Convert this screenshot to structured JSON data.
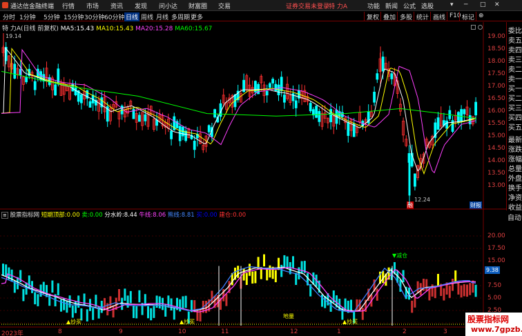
{
  "menu": {
    "app_title": "通达信金融终端",
    "items": [
      "行情",
      "市场",
      "资讯",
      "发现",
      "问小达",
      "财富圈",
      "交易"
    ],
    "login_status": "证券交易未登录",
    "stock_short": "特 力A",
    "right_items": [
      "功能",
      "新闻",
      "公式",
      "选股"
    ],
    "window_controls": [
      "▾",
      "─",
      "□",
      "✕"
    ]
  },
  "timeframes": {
    "items": [
      "分时",
      "1分钟",
      "5分钟",
      "15分钟",
      "30分钟",
      "60分钟",
      "日线",
      "周线",
      "月线",
      "多周期",
      "更多"
    ],
    "selected": "日线",
    "right_buttons": [
      "复权",
      "叠加",
      "多股",
      "统计",
      "画线",
      "F10",
      "标记",
      "⊕"
    ]
  },
  "main_chart": {
    "title": "特 力A",
    "mode": "(日线 前复权)",
    "ma": [
      {
        "label": "MA5:",
        "value": "15.43",
        "color": "#ffffff"
      },
      {
        "label": "MA10:",
        "value": "15.43",
        "color": "#ffff00"
      },
      {
        "label": "MA20:",
        "value": "15.28",
        "color": "#ff40ff"
      },
      {
        "label": "MA60:",
        "value": "15.67",
        "color": "#00ff00"
      }
    ],
    "high_marker": "19.14",
    "low_marker": "12.24",
    "y_ticks": [
      "19.00",
      "18.50",
      "18.00",
      "17.50",
      "17.00",
      "16.50",
      "16.00",
      "15.50",
      "15.00",
      "14.50",
      "14.00",
      "13.50",
      "13.00"
    ],
    "badge_left": "融",
    "badge_right": "财报"
  },
  "side_panel": [
    "委比",
    "卖五",
    "卖四",
    "卖三",
    "卖二",
    "卖一",
    "买一",
    "买二",
    "买三",
    "买四",
    "买五",
    "最新",
    "涨跌",
    "涨幅",
    "总量",
    "外盘",
    "换手",
    "净资",
    "收益"
  ],
  "indicator": {
    "name": "股票指标网",
    "items": [
      {
        "label": "短期顶部:",
        "value": "0.00",
        "color": "#ffff00"
      },
      {
        "label": "卖:",
        "value": "0.00",
        "color": "#00ff00"
      },
      {
        "label": "分水岭:",
        "value": "8.44",
        "color": "#ffffff"
      },
      {
        "label": "牛线:",
        "value": "8.06",
        "color": "#ff40ff"
      },
      {
        "label": "熊线:",
        "value": "8.81",
        "color": "#4080ff"
      },
      {
        "label": "买:",
        "value": "0.00",
        "color": "#0000ff"
      },
      {
        "label": "建仓:",
        "value": "0.00",
        "color": "#ff3030"
      }
    ],
    "y_ticks": [
      "20.00",
      "17.50",
      "15.00",
      "12.50",
      "10.00",
      "7.50",
      "5.00",
      "2.50"
    ],
    "current_value": "9.38",
    "panel_label": "自动",
    "annotations": {
      "buy": "▲抄买",
      "sell": "▼减仓",
      "bottom": "地量"
    }
  },
  "x_axis": {
    "year": "2023年",
    "months": [
      "8",
      "9",
      "10",
      "11",
      "12",
      "1",
      "2",
      "3"
    ]
  },
  "watermark": {
    "title": "股票指标网",
    "url": "www.7gpzb.com"
  },
  "colors": {
    "up": "#ff3030",
    "down": "#00ffff",
    "ma5": "#ffffff",
    "ma10": "#ffff00",
    "ma20": "#ff40ff",
    "ma60": "#00ff00"
  }
}
